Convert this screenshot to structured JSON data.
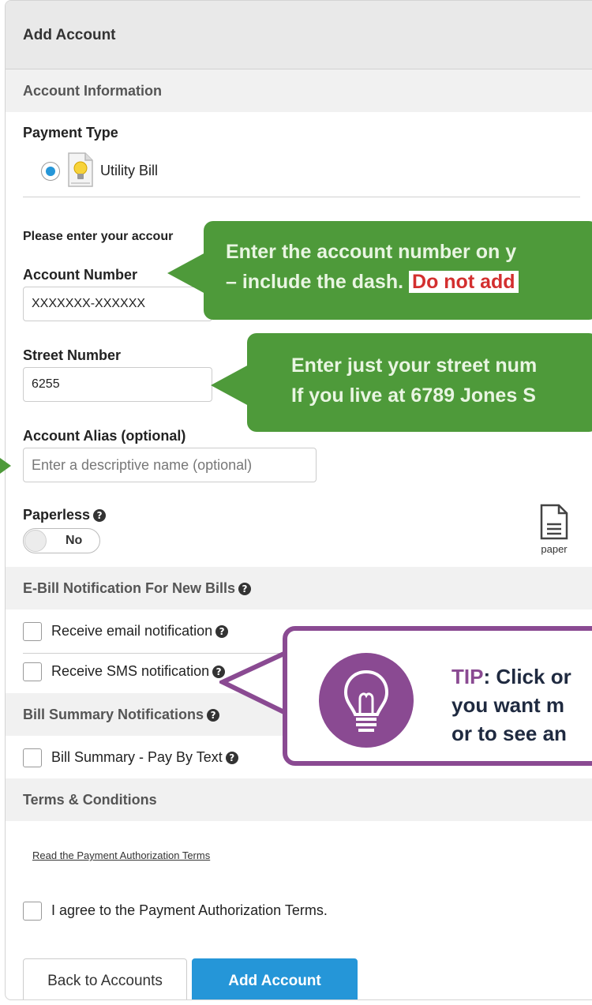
{
  "header": {
    "title": "Add Account"
  },
  "account_info": {
    "section_title": "Account Information",
    "payment_type_label": "Payment Type",
    "payment_option_label": "Utility Bill",
    "prompt_text": "Please enter your accour",
    "account_number_label": "Account Number",
    "account_number_value": "XXXXXXX-XXXXXX",
    "street_number_label": "Street Number",
    "street_number_value": "6255",
    "alias_label": "Account Alias (optional)",
    "alias_placeholder": "Enter a descriptive name (optional)",
    "paperless_label": "Paperless",
    "paperless_toggle": "No",
    "paper_icon_label": "paper"
  },
  "ebill": {
    "section_title": "E-Bill Notification For New Bills",
    "email_label": "Receive email notification",
    "sms_label": "Receive SMS notification"
  },
  "bill_summary": {
    "section_title": "Bill Summary Notifications",
    "pay_by_text_label": "Bill Summary - Pay By Text"
  },
  "terms": {
    "section_title": "Terms & Conditions",
    "link_text": "Read the Payment Authorization Terms",
    "agree_label": "I agree to the Payment Authorization Terms."
  },
  "buttons": {
    "back_label": "Back to Accounts",
    "add_label": "Add Account"
  },
  "callouts": {
    "account_line1": "Enter the account number on y",
    "account_line2": "– include the dash.",
    "account_warning": "Do not add",
    "street_line1": "Enter just your street num",
    "street_line2": "If you live at 6789 Jones S",
    "tip_keyword": "TIP",
    "tip_line1": ": Click or",
    "tip_line2": "you want m",
    "tip_line3": "or to see an"
  },
  "colors": {
    "accent_blue": "#2596d8",
    "callout_green": "#4e9a3a",
    "tip_purple": "#8a4a92",
    "warning_red": "#d32f2f"
  },
  "icons": [
    "lightbulb-icon",
    "help-icon",
    "paper-icon"
  ]
}
